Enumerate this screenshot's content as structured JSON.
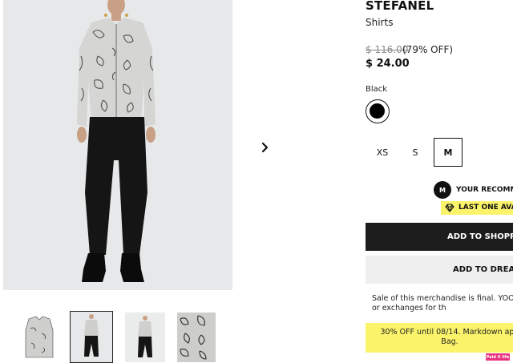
{
  "product": {
    "brand": "STEFANEL",
    "category": "Shirts",
    "price_original": "$ 116.00",
    "discount": "(79% OFF)",
    "price_current": "$ 24.00"
  },
  "color": {
    "label": "Black",
    "selected_hex": "#000000"
  },
  "sizes": [
    {
      "label": "XS",
      "selected": false
    },
    {
      "label": "S",
      "selected": false
    },
    {
      "label": "M",
      "selected": true
    }
  ],
  "recommended": {
    "badge": "M",
    "text": "YOUR RECOMME"
  },
  "stock": {
    "text": "LAST ONE AVA",
    "icon": "diamond-icon"
  },
  "actions": {
    "add_to_bag": "ADD TO SHOPPIN",
    "add_to_dream": "ADD TO DREAM"
  },
  "notices": {
    "sale": "Sale of this merchandise is final. YOOX\nor exchanges for th",
    "promo": "30% OFF until 08/14. Markdown app\nBag.",
    "paid_tag": "Paid X life"
  },
  "gallery": {
    "next_icon": "chevron-right-icon",
    "thumbnail_count": 4,
    "selected_index": 1
  },
  "colors": {
    "accent_yellow": "#fbf46b",
    "button_dark": "#1d1d1d",
    "button_light": "#efefef",
    "tag_pink": "#e8337f"
  }
}
